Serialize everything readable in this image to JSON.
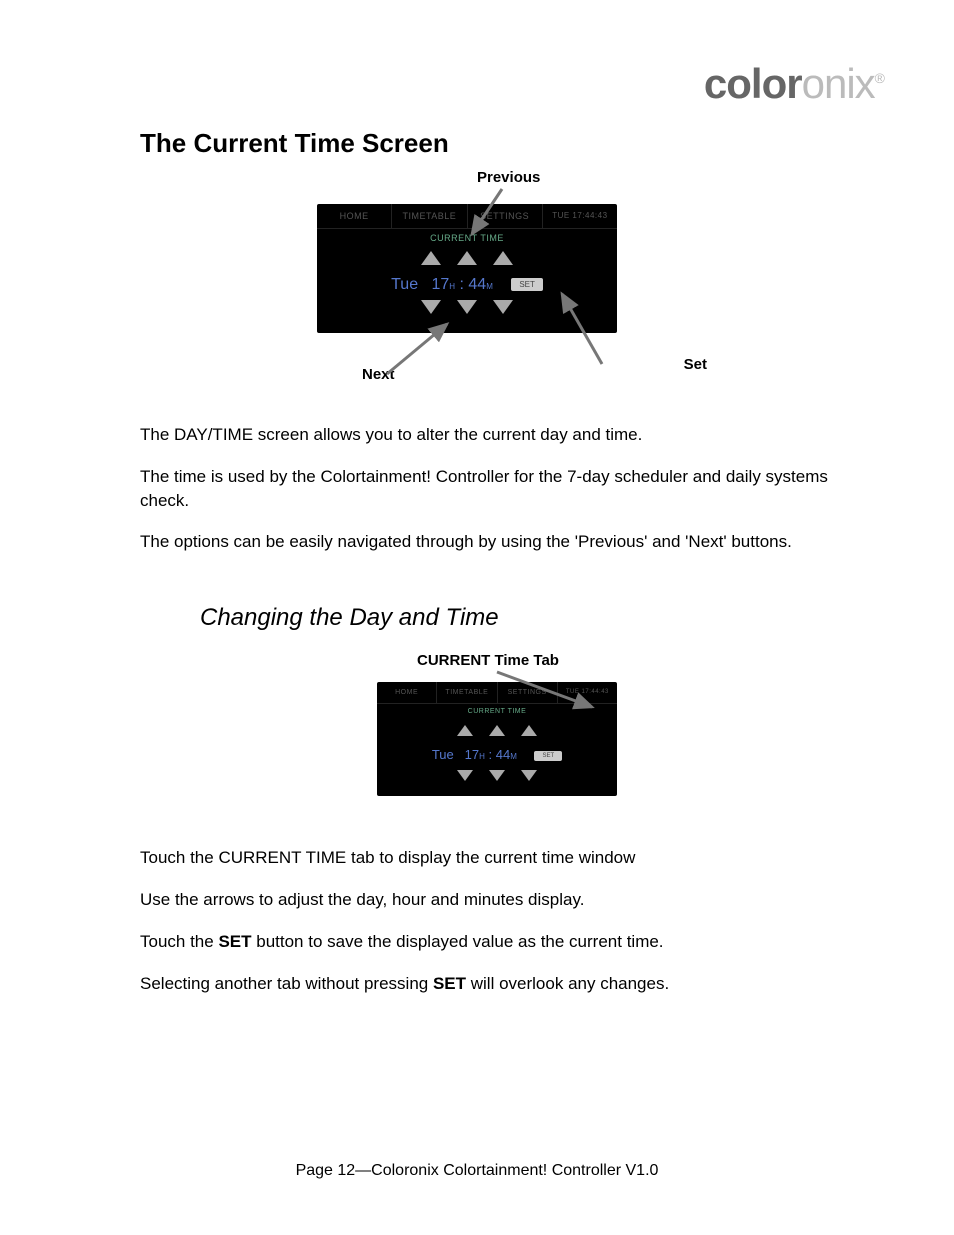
{
  "logo": {
    "part1": "color",
    "part2": "onix",
    "reg": "®"
  },
  "heading": "The Current Time Screen",
  "fig1": {
    "callouts": {
      "previous": "Previous",
      "next": "Next",
      "set": "Set"
    },
    "tabs": {
      "home": "HOME",
      "timetable": "TIMETABLE",
      "settings": "SETTINGS",
      "clock": "TUE 17:44:43"
    },
    "screen_title": "CURRENT TIME",
    "values": {
      "day": "Tue",
      "hour": "17",
      "h_suffix": "H",
      "sep": ":",
      "min": "44",
      "m_suffix": "M",
      "set": "SET"
    }
  },
  "para1": "The DAY/TIME screen allows you to alter the current day and time.",
  "para2": "The time is used by the Colortainment! Controller for the 7-day scheduler and daily systems check.",
  "para3": "The options can be easily navigated through by using the 'Previous' and 'Next' buttons.",
  "sub_heading": "Changing the Day and Time",
  "fig2": {
    "callout": "CURRENT Time Tab",
    "tabs": {
      "home": "HOME",
      "timetable": "TIMETABLE",
      "settings": "SETTINGS",
      "clock": "TUE 17:44:43"
    },
    "screen_title": "CURRENT TIME",
    "values": {
      "day": "Tue",
      "hour": "17",
      "h_suffix": "H",
      "sep": ":",
      "min": "44",
      "m_suffix": "M",
      "set": "SET"
    }
  },
  "para4": "Touch the CURRENT TIME tab to display the current time window",
  "para5": "Use the arrows to adjust the day, hour and minutes display.",
  "para6_a": "Touch the ",
  "para6_b": "SET",
  "para6_c": " button to save the displayed value as the current time.",
  "para7_a": "Selecting another tab without pressing ",
  "para7_b": "SET",
  "para7_c": " will overlook any changes.",
  "footer": "Page 12—Coloronix Colortainment! Controller V1.0"
}
